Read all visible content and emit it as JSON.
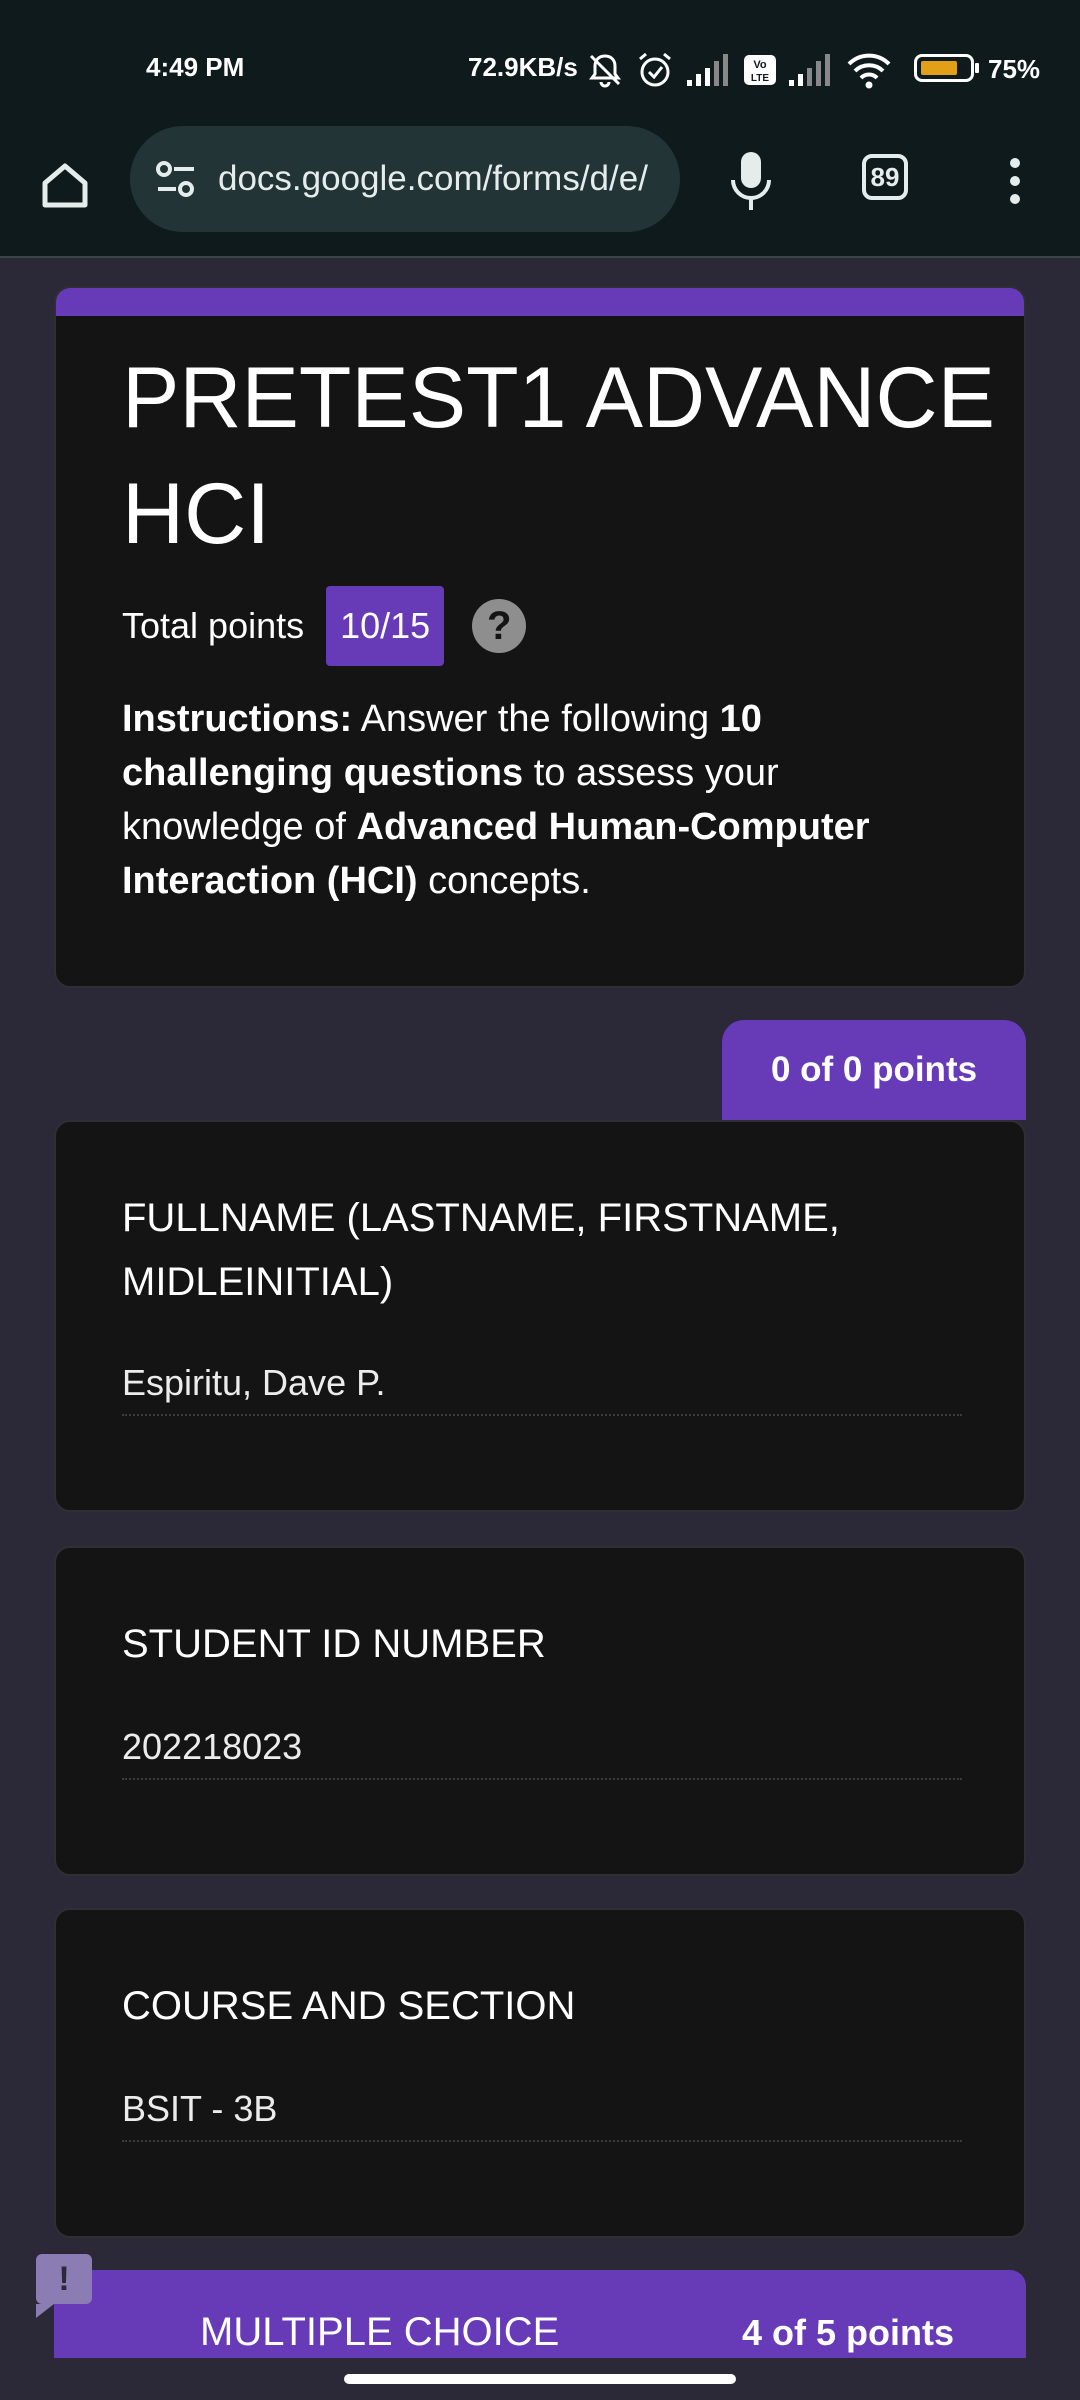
{
  "status_bar": {
    "time": "4:49 PM",
    "net_speed": "72.9KB/s",
    "battery_percent": "75%",
    "battery_level": 0.75,
    "battery_color": "#e2a018",
    "icons": [
      "mute-icon",
      "alarm-icon",
      "signal-icon",
      "volte-icon",
      "signal-icon",
      "wifi-icon",
      "battery-icon"
    ]
  },
  "browser": {
    "url": "docs.google.com/forms/d/e/",
    "tab_count": "89",
    "icons": [
      "home-icon",
      "site-settings-icon",
      "mic-icon",
      "tabs-icon",
      "more-vert-icon"
    ]
  },
  "form": {
    "accent_color": "#673ab7",
    "title": "PRETEST1 ADVANCE HCI",
    "total_points_label": "Total points",
    "total_points_value": "10/15",
    "instructions": {
      "p1": "Instructions:",
      "p2": " Answer the following ",
      "p3": "10 challenging questions",
      "p4": " to assess your knowledge of ",
      "p5": "Advanced Human-Computer Interaction (HCI)",
      "p6": " concepts."
    }
  },
  "section_points": "0 of 0 points",
  "questions": [
    {
      "label": "FULLNAME (LASTNAME, FIRSTNAME, MIDLEINITIAL)",
      "answer": "Espiritu, Dave P."
    },
    {
      "label": "STUDENT ID NUMBER",
      "answer": "202218023"
    },
    {
      "label": "COURSE AND SECTION",
      "answer": "BSIT - 3B"
    }
  ],
  "next_section": {
    "title": "MULTIPLE CHOICE",
    "points": "4 of 5 points"
  },
  "feedback_button": "!"
}
